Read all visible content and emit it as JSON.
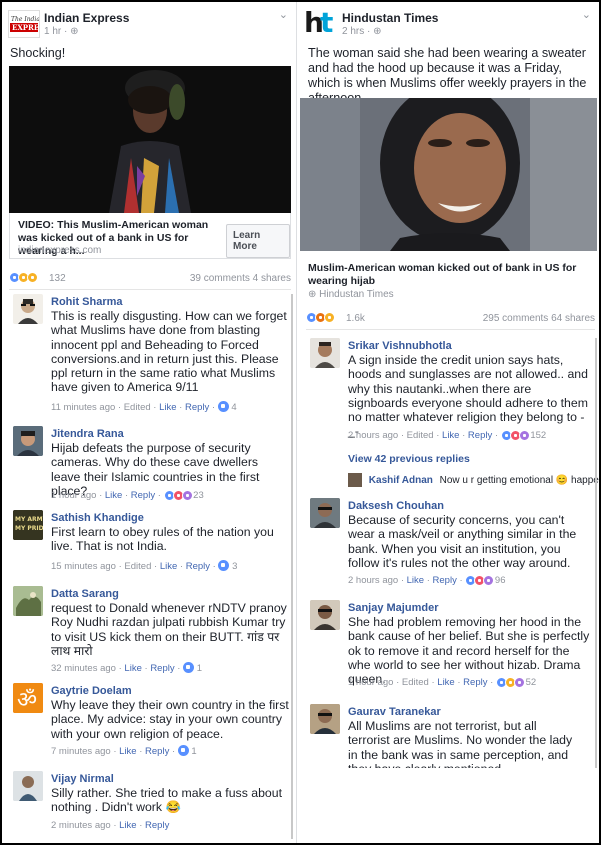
{
  "left": {
    "page_name": "Indian Express",
    "meta_time": "1 hr · ",
    "logo_text": "The Indian EXPRESS",
    "post_text": "Shocking!",
    "link_title": "VIDEO: This Muslim-American woman was kicked out of a bank in US for wearing a h...",
    "link_source": "indianexpress.com",
    "learn_more": "Learn More",
    "reaction_count": "132",
    "comments_shares": "39 comments  4 shares",
    "comments": [
      {
        "name": "Rohit Sharma",
        "text": "This is really disgusting. How can we forget what Muslims have done from blasting innocent ppl and Beheading to Forced conversions.and in  return just this. Please ppl return in the same ratio what Muslims have given  to America 9/11",
        "time": "11 minutes ago",
        "edited": "Edited",
        "like": "Like",
        "reply": "Reply",
        "count": "4"
      },
      {
        "name": "Jitendra Rana",
        "text": "Hijab defeats the purpose of security cameras. Why do these cave dwellers leave their Islamic countries in the first place?",
        "time": "1 hour ago",
        "like": "Like",
        "reply": "Reply",
        "count": "23"
      },
      {
        "name": "Sathish Khandige",
        "text": "First learn to obey rules of the nation you live. That is not India.",
        "time": "15 minutes ago",
        "edited": "Edited",
        "like": "Like",
        "reply": "Reply",
        "count": "3",
        "avatar_text": "MY ARMY MY PRIDE"
      },
      {
        "name": "Datta Sarang",
        "text": "request to Donald whenever rNDTV pranoy Roy Nudhi razdan julpati rubbish Kumar try to visit US kick them on their BUTT. गांड पर लाथ मारो",
        "time": "32 minutes ago",
        "like": "Like",
        "reply": "Reply",
        "count": "1"
      },
      {
        "name": "Gaytrie Doelam",
        "text": "Why leave they their own country in the first place. My advice: stay in your own country with your own religion of peace.",
        "time": "7 minutes ago",
        "like": "Like",
        "reply": "Reply",
        "count": "1"
      },
      {
        "name": "Vijay Nirmal",
        "text": "Silly rather. She tried to make a fuss about nothing . Didn't work 😂",
        "time": "2 minutes ago",
        "like": "Like",
        "reply": "Reply"
      }
    ]
  },
  "right": {
    "page_name": "Hindustan Times",
    "meta_time": "2 hrs · ",
    "logo_text": "ht",
    "post_text": "The woman said she had been wearing a sweater and had the hood up because it was a Friday, which is when Muslims offer weekly prayers in the afternoon.",
    "link_title": "Muslim-American woman kicked out of bank in US for wearing hijab",
    "link_source": "Hindustan Times",
    "reaction_count": "1.6k",
    "comments_shares": "295 comments  64 shares",
    "view_replies": "View 42 previous replies",
    "reply_name": "Kashif Adnan",
    "reply_text": "Now u r getting emotional 😊 happe...",
    "comments": [
      {
        "name": "Srikar Vishnubhotla",
        "text": "A sign inside the credit union says hats, hoods and sunglasses are not allowed.. and why this nautanki..when there are signboards everyone should adhere to them no matter whatever religion they belong to -_-",
        "time": "2 hours ago",
        "edited": "Edited",
        "like": "Like",
        "reply": "Reply",
        "count": "152"
      },
      {
        "name": "Daksesh Chouhan",
        "text": "Because of security concerns, you can't wear a mask/veil or anything similar in the bank. When you visit an institution, you follow it's rules not the other way around.",
        "time": "2 hours ago",
        "like": "Like",
        "reply": "Reply",
        "count": "96"
      },
      {
        "name": "Sanjay Majumder",
        "text": "She had problem removing her hood in the bank cause of her belief. But she is perfectly ok to remove it and record herself for the whe world to see her without hizab. Drama queen.",
        "time": "1 hour ago",
        "edited": "Edited",
        "like": "Like",
        "reply": "Reply",
        "count": "52"
      },
      {
        "name": "Gaurav Taranekar",
        "text": "All Muslims are not terrorist, but all terrorist are Muslims. No wonder the lady in the bank was in same perception, and they have clearly mentioned",
        "time": ""
      }
    ]
  },
  "colors": {
    "link": "#365899",
    "action": "#4267b2",
    "meta": "#90949c",
    "text": "#1d2129"
  }
}
